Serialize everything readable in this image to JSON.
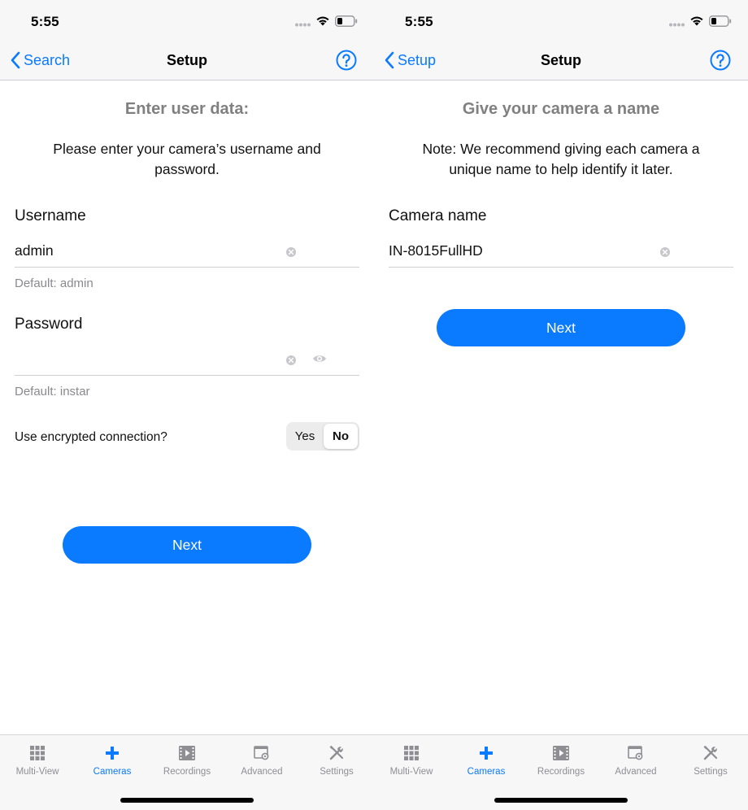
{
  "left": {
    "status": {
      "time": "5:55"
    },
    "nav": {
      "back_label": "Search",
      "title": "Setup"
    },
    "heading": "Enter user data:",
    "description": "Please enter your camera’s username and password.",
    "username": {
      "label": "Username",
      "value": "admin",
      "hint": "Default: admin"
    },
    "password": {
      "label": "Password",
      "value": "",
      "hint": "Default: instar"
    },
    "encrypted": {
      "label": "Use encrypted connection?",
      "options": [
        "Yes",
        "No"
      ],
      "selected": "No"
    },
    "next_label": "Next"
  },
  "right": {
    "status": {
      "time": "5:55"
    },
    "nav": {
      "back_label": "Setup",
      "title": "Setup"
    },
    "heading": "Give your camera a name",
    "description": "Note: We recommend giving each camera a unique name to help identify it later.",
    "camera_name": {
      "label": "Camera name",
      "value": "IN-8015FullHD"
    },
    "next_label": "Next"
  },
  "tabs": [
    {
      "label": "Multi-View",
      "icon": "grid-icon",
      "active": false
    },
    {
      "label": "Cameras",
      "icon": "plus-icon",
      "active": true
    },
    {
      "label": "Recordings",
      "icon": "film-icon",
      "active": false
    },
    {
      "label": "Advanced",
      "icon": "window-gear-icon",
      "active": false
    },
    {
      "label": "Settings",
      "icon": "tools-icon",
      "active": false
    }
  ],
  "colors": {
    "accent": "#0a7aff",
    "heading_gray": "#808080",
    "hint_gray": "#8a8a8e",
    "bar_bg": "#f7f7f7"
  }
}
